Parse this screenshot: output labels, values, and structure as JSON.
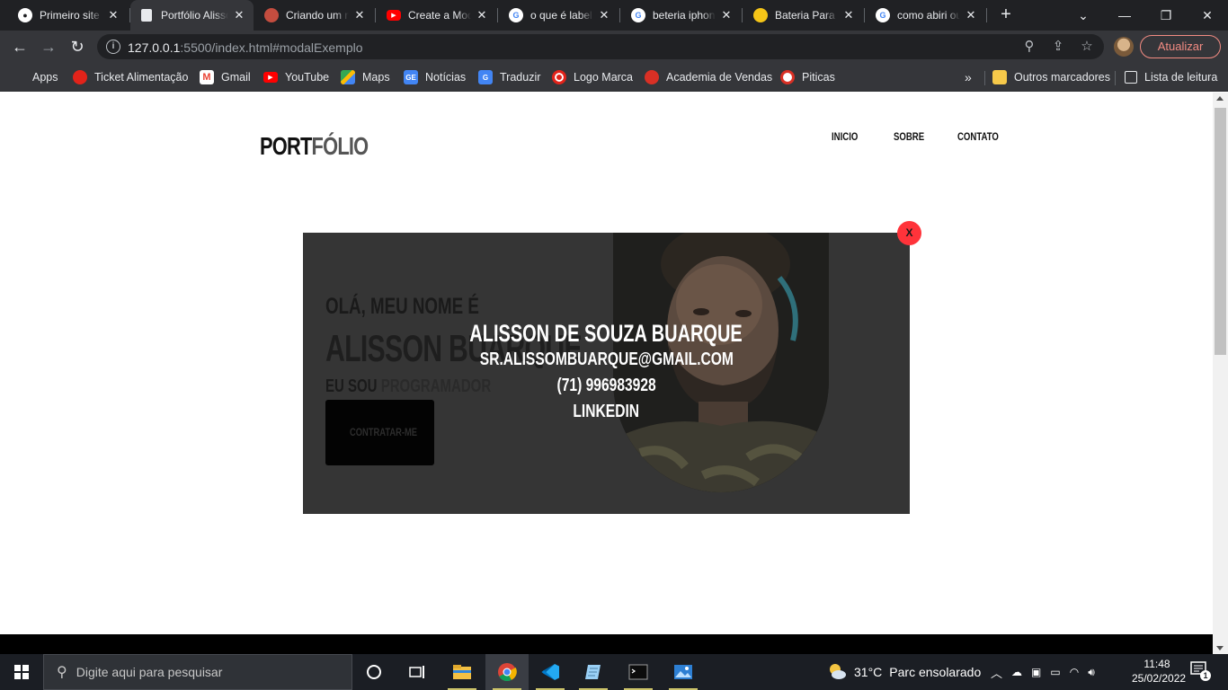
{
  "browser": {
    "tabs": [
      {
        "title": "Primeiro site",
        "favicon": "github-icon",
        "favicon_color": "#ffffff"
      },
      {
        "title": "Portfólio Alisson",
        "favicon": "page-icon",
        "favicon_color": "#e8eaed",
        "active": true
      },
      {
        "title": "Criando um modal",
        "favicon": "user-avatar-icon",
        "favicon_color": "#c44d3f"
      },
      {
        "title": "Create a Modal",
        "favicon": "youtube-icon",
        "favicon_color": "#ff0000"
      },
      {
        "title": "o que é label",
        "favicon": "google-icon",
        "favicon_color": "#4285f4"
      },
      {
        "title": "beteria iphone",
        "favicon": "google-icon",
        "favicon_color": "#4285f4"
      },
      {
        "title": "Bateria Para iPhone",
        "favicon": "store-icon",
        "favicon_color": "#f5c518"
      },
      {
        "title": "como abiri ou",
        "favicon": "google-icon",
        "favicon_color": "#4285f4"
      }
    ],
    "url_host": "127.0.0.1",
    "url_rest": ":5500/index.html#modalExemplo",
    "update_label": "Atualizar"
  },
  "bookmarks": [
    {
      "label": "Apps",
      "icon": "apps-grid-icon",
      "color": "#ea4335"
    },
    {
      "label": "Ticket Alimentação",
      "icon": "ticket-icon",
      "color": "#e2231a"
    },
    {
      "label": "Gmail",
      "icon": "gmail-icon",
      "color": "#ea4335"
    },
    {
      "label": "YouTube",
      "icon": "youtube-icon",
      "color": "#ff0000"
    },
    {
      "label": "Maps",
      "icon": "maps-icon",
      "color": "#34a853"
    },
    {
      "label": "Notícias",
      "icon": "news-icon",
      "color": "#4285f4"
    },
    {
      "label": "Traduzir",
      "icon": "translate-icon",
      "color": "#4285f4"
    },
    {
      "label": "Logo Marca",
      "icon": "logo-icon",
      "color": "#e2231a"
    },
    {
      "label": "Academia de Vendas",
      "icon": "academy-icon",
      "color": "#d93025"
    },
    {
      "label": "Piticas",
      "icon": "piticas-icon",
      "color": "#d93025"
    }
  ],
  "bookmarks_right": {
    "more": "»",
    "other": "Outros marcadores",
    "reading_list": "Lista de leitura"
  },
  "site": {
    "logo_main": "PORT",
    "logo_accent": "FÓLIO",
    "nav": [
      "INICIO",
      "SOBRE",
      "CONTATO"
    ],
    "greeting": "Olá, meu nome é",
    "hero_name": "Alisson Buarque",
    "role_prefix": "Eu sou",
    "role": "programador",
    "hire_button": "Contratar-me"
  },
  "modal": {
    "name": "Alisson de Souza Buarque",
    "email": "sr.alissombuarque@gmail.com",
    "phone": "(71) 996983928",
    "linkedin": "Linkedin",
    "close": "X"
  },
  "taskbar": {
    "search_placeholder": "Digite aqui para pesquisar",
    "weather_temp": "31°C",
    "weather_text": "Parc ensolarado",
    "time": "11:48",
    "date": "25/02/2022",
    "notifications": "1"
  }
}
